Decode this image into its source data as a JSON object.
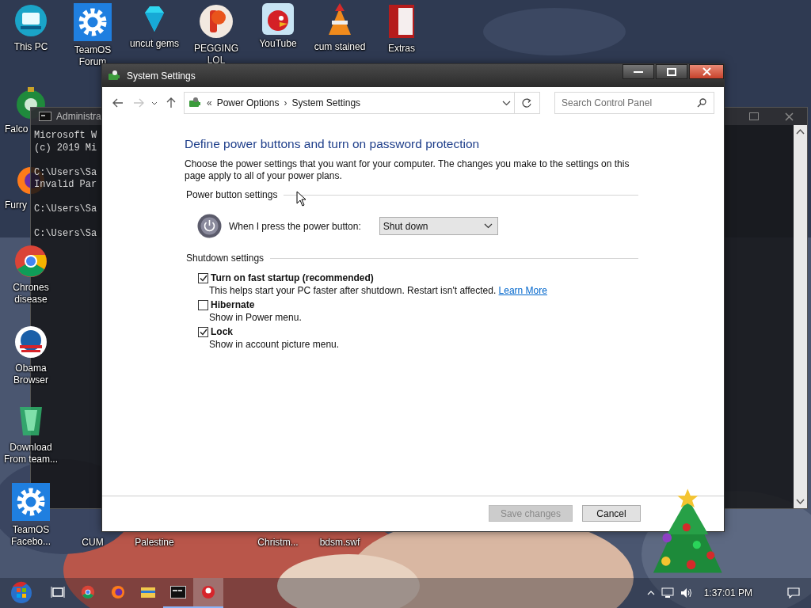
{
  "desktop_icons": [
    {
      "label": "This PC",
      "kind": "monitor"
    },
    {
      "label": "TeamOS Forum",
      "kind": "gear"
    },
    {
      "label": "uncut gems",
      "kind": "gem"
    },
    {
      "label": "PEGGING LOL",
      "kind": "letter-badge"
    },
    {
      "label": "YouTube",
      "kind": "bird"
    },
    {
      "label": "cum stained",
      "kind": "cone"
    },
    {
      "label": "Extras",
      "kind": "book"
    },
    {
      "label": "Falco",
      "kind": "ornament"
    },
    {
      "label": "Furry",
      "kind": "fox"
    },
    {
      "label": "Chrones disease",
      "kind": "chrome"
    },
    {
      "label": "Obama Browser",
      "kind": "round-logo"
    },
    {
      "label": "Download From team...",
      "kind": "download"
    },
    {
      "label": "TeamOS Facebo...",
      "kind": "gear"
    },
    {
      "label": "CUM",
      "kind": "none"
    },
    {
      "label": "Palestine",
      "kind": "none"
    },
    {
      "label": "Christm...",
      "kind": "none"
    },
    {
      "label": "bdsm.swf",
      "kind": "none"
    }
  ],
  "console_window": {
    "title": "Administra",
    "blocks": [
      [
        "Microsoft W",
        "(c) 2019 Mi"
      ],
      [
        "C:\\Users\\Sa",
        "Invalid Par"
      ],
      [
        "C:\\Users\\Sa"
      ],
      [
        "C:\\Users\\Sa"
      ]
    ]
  },
  "settings_window": {
    "title": "System Settings",
    "breadcrumb": {
      "overflow": "«",
      "separator": "›",
      "items": [
        "Power Options",
        "System Settings"
      ]
    },
    "search": {
      "placeholder": "Search Control Panel"
    },
    "heading": "Define power buttons and turn on password protection",
    "description": "Choose the power settings that you want for your computer. The changes you make to the settings on this page apply to all of your power plans.",
    "power_section": {
      "title": "Power button settings",
      "label": "When I press the power button:",
      "value": "Shut down"
    },
    "shutdown_section": {
      "title": "Shutdown settings",
      "options": [
        {
          "label": "Turn on fast startup (recommended)",
          "checked": true,
          "note": "This helps start your PC faster after shutdown. Restart isn't affected.",
          "link": "Learn More"
        },
        {
          "label": "Hibernate",
          "checked": false,
          "note": "Show in Power menu."
        },
        {
          "label": "Lock",
          "checked": true,
          "note": "Show in account picture menu."
        }
      ]
    },
    "buttons": [
      {
        "label": "Save changes",
        "disabled": true
      },
      {
        "label": "Cancel",
        "disabled": false
      }
    ]
  },
  "taskbar": {
    "apps": [
      {
        "kind": "start",
        "running": false,
        "active": false
      },
      {
        "kind": "task-view",
        "running": false,
        "active": false
      },
      {
        "kind": "chrome",
        "running": false,
        "active": false
      },
      {
        "kind": "firefox",
        "running": false,
        "active": false
      },
      {
        "kind": "folder",
        "running": false,
        "active": false
      },
      {
        "kind": "console",
        "running": true,
        "active": false
      },
      {
        "kind": "app",
        "running": true,
        "active": true
      }
    ],
    "clock": "1:37:01 PM"
  }
}
